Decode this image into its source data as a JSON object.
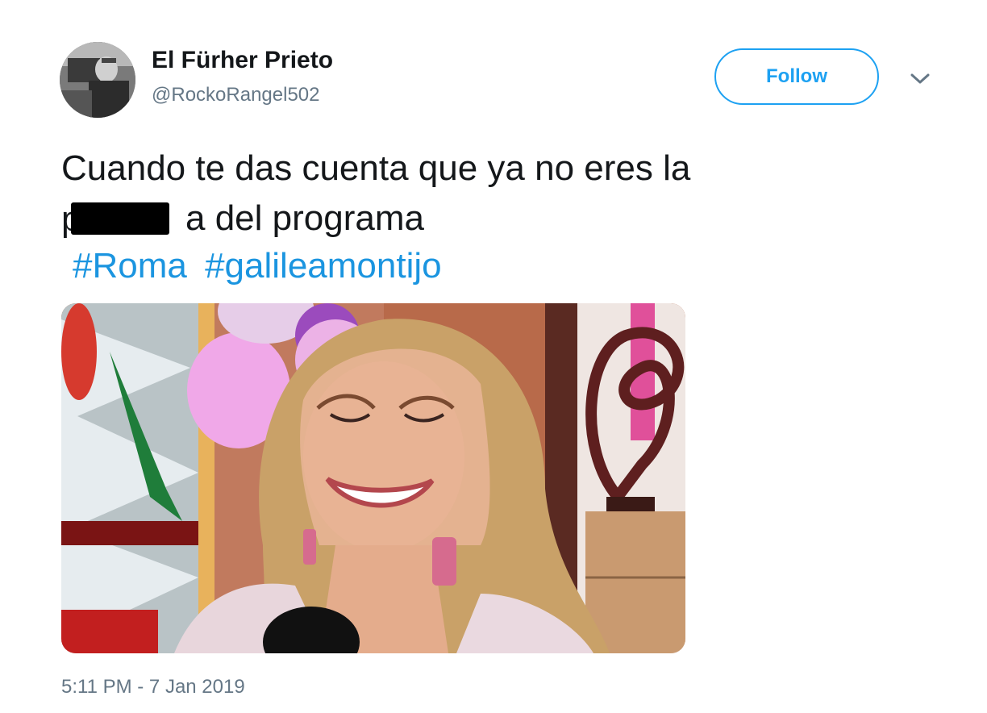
{
  "tweet": {
    "author": {
      "display_name": "El Fürher Prieto",
      "handle": "@RockoRangel502"
    },
    "follow_label": "Follow",
    "text": {
      "line1": "Cuando te das cuenta que ya no eres la",
      "line2_prefix": "p",
      "line2_suffix": "a del programa"
    },
    "hashtags": [
      "#Roma",
      "#galileamontijo"
    ],
    "timestamp": "5:11 PM - 7 Jan 2019"
  },
  "colors": {
    "accent": "#1da1f2",
    "link": "#1b95e0",
    "secondary_text": "#657786"
  },
  "icons": {
    "more": "chevron-down-icon"
  }
}
